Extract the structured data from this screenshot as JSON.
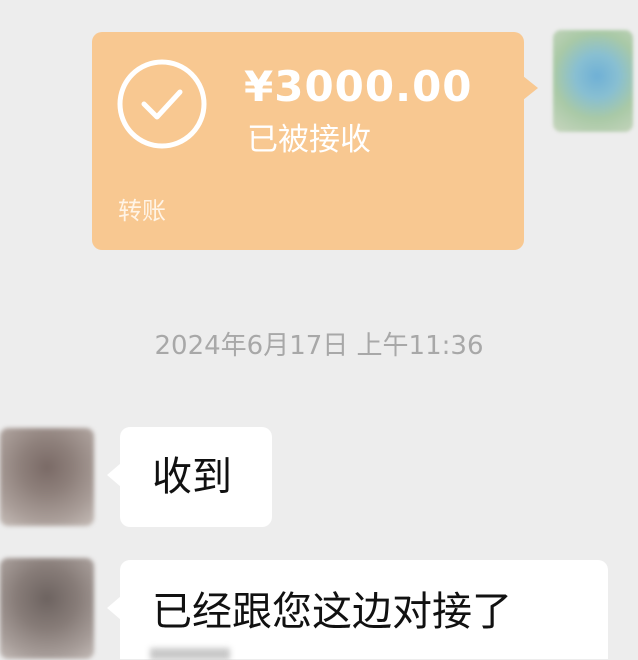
{
  "colors": {
    "background": "#ededed",
    "transfer_card": "#f8c891",
    "bubble": "#ffffff",
    "timestamp_text": "#a8a8a8"
  },
  "transfer": {
    "amount": "¥3000.00",
    "status": "已被接收",
    "label": "转账",
    "icon": "check-circle-icon"
  },
  "timestamp": "2024年6月17日 上午11:36",
  "messages": [
    {
      "sender": "other",
      "text": "收到"
    },
    {
      "sender": "other",
      "text": "已经跟您这边对接了"
    }
  ]
}
